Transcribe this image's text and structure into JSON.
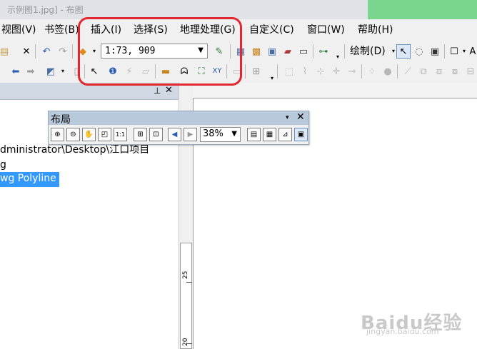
{
  "window": {
    "title_fragment": "示例图1.jpg] - 布图"
  },
  "menubar": {
    "items": [
      {
        "label": "视图(V)"
      },
      {
        "label": "书签(B)"
      },
      {
        "label": "插入(I)"
      },
      {
        "label": "选择(S)"
      },
      {
        "label": "地理处理(G)"
      },
      {
        "label": "自定义(C)"
      },
      {
        "label": "窗口(W)"
      },
      {
        "label": "帮助(H)"
      }
    ]
  },
  "toolbar": {
    "scale_value": "1:73, 909",
    "draw_label": "绘制(D)",
    "font_glyph": "A"
  },
  "left_pane": {
    "path_text": "dministrator\\Desktop\\江口项目",
    "path_line2": "g",
    "selected_layer": "wg Polyline"
  },
  "layout_toolbar": {
    "title": "布局",
    "zoom_value": "38%"
  },
  "ruler": {
    "labels": [
      "25",
      "20"
    ]
  },
  "watermark": {
    "brand": "Baidu经验",
    "url": "jingyan.baidu.com"
  },
  "annotation": {
    "color": "#e3262f"
  }
}
